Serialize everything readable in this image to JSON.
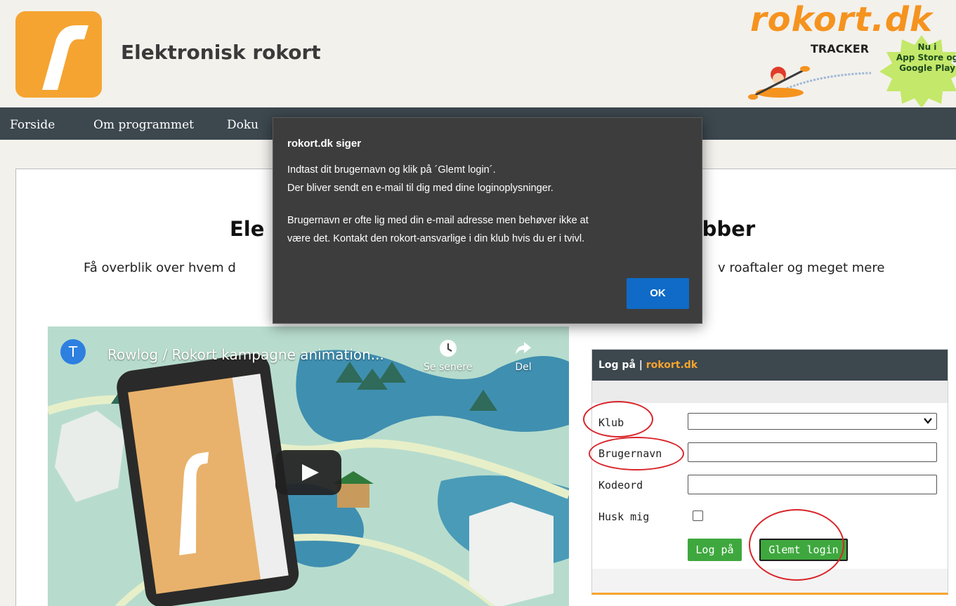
{
  "header": {
    "site_title": "Elektronisk rokort",
    "ad": {
      "brand": "rokort.dk",
      "tracker": "TRACKER",
      "badge_lines": [
        "Nu i",
        "App Store og",
        "Google Play"
      ]
    }
  },
  "nav": {
    "items": [
      "Forside",
      "Om programmet",
      "Doku"
    ]
  },
  "hero": {
    "title_start": "Ele",
    "title_end": "ubber",
    "subtitle_start": "Få overblik over hvem d",
    "subtitle_end": "v roaftaler og meget mere"
  },
  "video": {
    "channel_initial": "T",
    "title": "Rowlog / Rokort kampagne animation...",
    "watch_later": "Se senere",
    "share": "Del"
  },
  "login": {
    "header_prefix": "Log på | ",
    "header_brand": "rokort.dk",
    "club_label": "Klub",
    "username_label": "Brugernavn",
    "password_label": "Kodeord",
    "remember_label": "Husk mig",
    "login_button": "Log på",
    "forgot_button": "Glemt login",
    "club_value": "",
    "username_value": "",
    "password_value": "",
    "remember_checked": false
  },
  "dialog": {
    "title": "rokort.dk siger",
    "line1": "Indtast dit brugernavn og klik på ´Glemt login´.",
    "line2": "Der bliver sendt en e-mail til dig med dine loginoplysninger.",
    "line3": "Brugernavn er ofte lig med din e-mail adresse men behøver ikke at",
    "line4": "være det. Kontakt den rokort-ansvarlige i din klub hvis du er i tvivl.",
    "ok_label": "OK"
  },
  "colors": {
    "brand_orange": "#f5a431",
    "nav_bg": "#3c474e",
    "button_green": "#3ea83e",
    "dialog_bg": "#3d3d3d",
    "ok_blue": "#0f6bc7",
    "annotation_red": "#d8252a"
  }
}
